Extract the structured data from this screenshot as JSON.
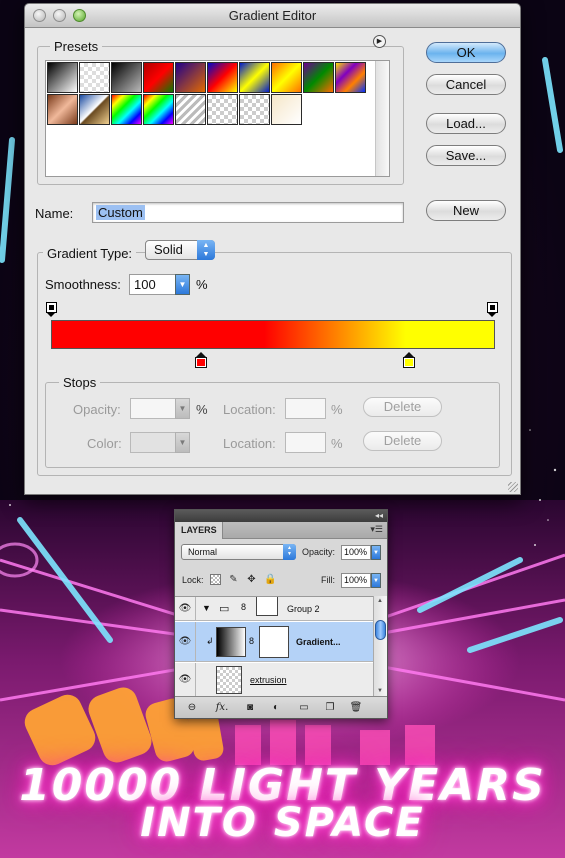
{
  "window": {
    "title": "Gradient Editor"
  },
  "presets": {
    "label": "Presets",
    "swatches": [
      {
        "name": "black-white",
        "bg": "linear-gradient(135deg,#000,#fff)"
      },
      {
        "name": "transparent",
        "bg": "repeating-conic-gradient(#ddd 0 25%, #fff 0 50%) 0 0/8px 8px"
      },
      {
        "name": "black-transparent",
        "bg": "linear-gradient(135deg,#000,#bbb)"
      },
      {
        "name": "red-green",
        "bg": "linear-gradient(135deg,#b00000,#f00 50%,#0a7a00)"
      },
      {
        "name": "violet-orange",
        "bg": "linear-gradient(135deg,#20008a,#e46b00)"
      },
      {
        "name": "blue-red-yellow",
        "bg": "linear-gradient(135deg,#0008c8,#ff0000 50%,#ffff00)"
      },
      {
        "name": "blue-yellow-blue",
        "bg": "linear-gradient(135deg,#001acc,#ffff00 50%,#001acc)"
      },
      {
        "name": "orange-yellow-orange",
        "bg": "linear-gradient(135deg,#ff7000,#ffff00 50%,#ff7000)"
      },
      {
        "name": "violet-green-orange",
        "bg": "linear-gradient(135deg,#6a0090,#008a00 50%,#ff6a00)"
      },
      {
        "name": "yellow-violet-orange-blue",
        "bg": "linear-gradient(135deg,#ffe000,#8000c0 35%,#ff8000 65%,#0030ff)"
      },
      {
        "name": "copper",
        "bg": "linear-gradient(135deg,#7a3b1b,#f0b89a 50%,#7a3b1b)"
      },
      {
        "name": "chrome",
        "bg": "linear-gradient(135deg,#1a4aa0,#ffffff 48%,#6a4a20 52%,#f0d090)"
      },
      {
        "name": "spectrum",
        "bg": "linear-gradient(135deg,#f00,#ff0 20%,#0f0 40%,#0ff 60%,#00f 80%,#f0f)"
      },
      {
        "name": "transparent-rainbow",
        "bg": "linear-gradient(135deg,#f00,#ff0,#0f0,#0ff,#00f,#f0f)"
      },
      {
        "name": "transparent-stripes",
        "bg": "repeating-linear-gradient(135deg,#bbb 0 3px,#fff 3px 6px)"
      },
      {
        "name": "checker-1",
        "bg": "repeating-conic-gradient(#ccc 0 25%, #fff 0 50%) 0 0/8px 8px"
      },
      {
        "name": "checker-2",
        "bg": "repeating-conic-gradient(#ccc 0 25%, #fff 0 50%) 0 0/8px 8px"
      },
      {
        "name": "beige-transparent",
        "bg": "linear-gradient(135deg,#f5e6c8,#fff)"
      }
    ]
  },
  "buttons": {
    "ok": "OK",
    "cancel": "Cancel",
    "load": "Load...",
    "save": "Save...",
    "new": "New"
  },
  "name_field": {
    "label": "Name:",
    "value": "Custom"
  },
  "gradient": {
    "type_label": "Gradient Type:",
    "type_value": "Solid",
    "smoothness_label": "Smoothness:",
    "smoothness_value": "100",
    "smoothness_unit": "%",
    "color_stops": [
      {
        "color": "#ff0000",
        "location": 0.34
      },
      {
        "color": "#ffff00",
        "location": 0.81
      }
    ]
  },
  "stops": {
    "label": "Stops",
    "opacity_label": "Opacity:",
    "opacity_unit": "%",
    "color_label": "Color:",
    "location_label": "Location:",
    "location_unit": "%",
    "delete_label": "Delete"
  },
  "layers": {
    "tab_label": "LAYERS",
    "blend_mode": "Normal",
    "opacity_label": "Opacity:",
    "opacity_value": "100%",
    "lock_label": "Lock:",
    "fill_label": "Fill:",
    "fill_value": "100%",
    "rows": [
      {
        "name": "Group 2",
        "selected": false
      },
      {
        "name": "Gradient...",
        "selected": true
      },
      {
        "name": "extrusion",
        "selected": false
      }
    ]
  },
  "poster": {
    "line1": "10000 LIGHT YEARS",
    "line2": "INTO SPACE"
  }
}
